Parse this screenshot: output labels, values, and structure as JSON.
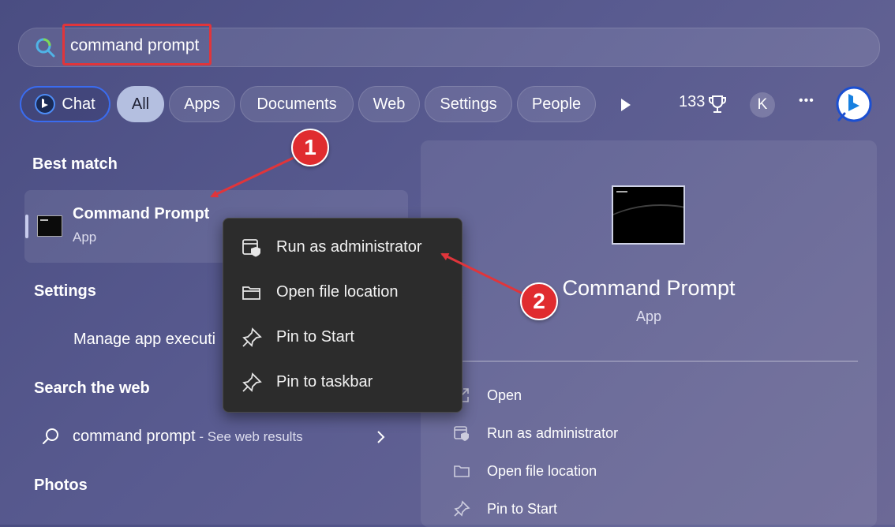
{
  "search": {
    "query": "command prompt"
  },
  "filters": {
    "chat": "Chat",
    "chips": [
      "All",
      "Apps",
      "Documents",
      "Web",
      "Settings",
      "People"
    ],
    "points": "133",
    "avatar_letter": "K",
    "more": "•••"
  },
  "results": {
    "best_match_title": "Best match",
    "best_match": {
      "name": "Command Prompt",
      "type": "App"
    },
    "settings_title": "Settings",
    "settings_item": "Manage app executi",
    "web_title": "Search the web",
    "web_item": {
      "query": "command prompt",
      "suffix": " - See web results"
    },
    "photos_title": "Photos"
  },
  "context_menu": {
    "items": [
      "Run as administrator",
      "Open file location",
      "Pin to Start",
      "Pin to taskbar"
    ]
  },
  "preview": {
    "name": "Command Prompt",
    "type": "App",
    "actions": [
      "Open",
      "Run as administrator",
      "Open file location",
      "Pin to Start"
    ]
  },
  "annotations": {
    "badge1": "1",
    "badge2": "2"
  },
  "colors": {
    "accent_red": "#e0353b",
    "chip_active": "#b4bfe0",
    "chat_border": "#3a6cf0"
  }
}
